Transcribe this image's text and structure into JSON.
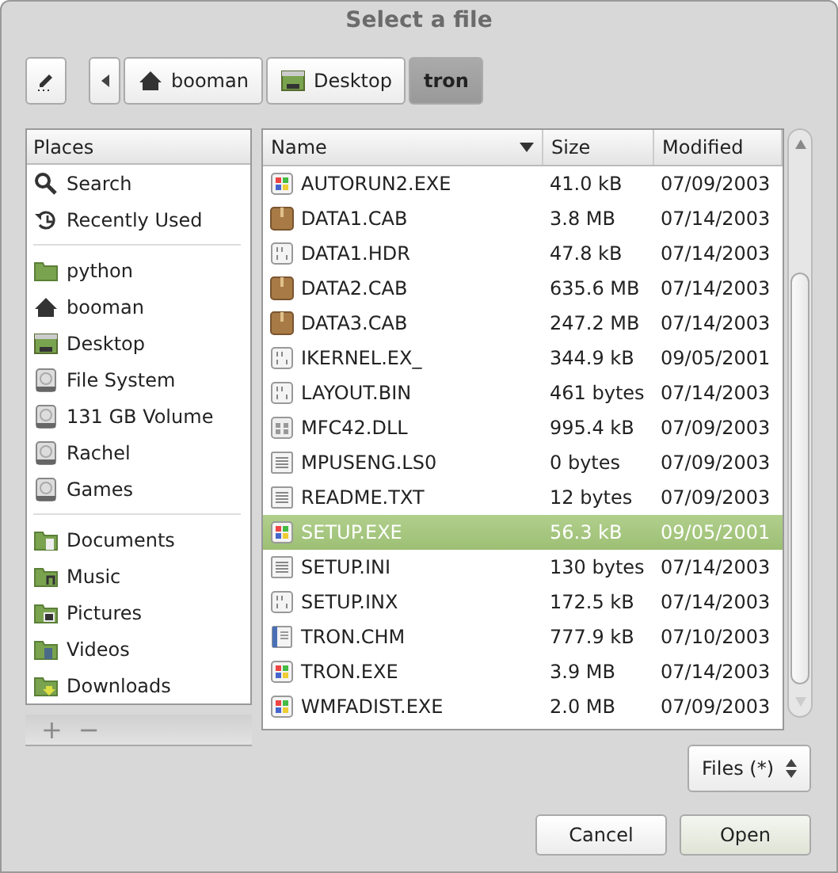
{
  "window": {
    "title": "Select a file"
  },
  "path_bar": {
    "buttons": [
      {
        "label": "booman",
        "kind": "home",
        "selected": false
      },
      {
        "label": "Desktop",
        "kind": "desktop",
        "selected": false
      },
      {
        "label": "tron",
        "kind": "plain",
        "selected": true
      }
    ]
  },
  "places": {
    "header": "Places",
    "sections": [
      [
        {
          "label": "Search",
          "kind": "search"
        },
        {
          "label": "Recently Used",
          "kind": "recent"
        }
      ],
      [
        {
          "label": "python",
          "kind": "folder"
        },
        {
          "label": "booman",
          "kind": "home"
        },
        {
          "label": "Desktop",
          "kind": "desktop"
        },
        {
          "label": "File System",
          "kind": "drive"
        },
        {
          "label": "131 GB Volume",
          "kind": "drive"
        },
        {
          "label": "Rachel",
          "kind": "drive"
        },
        {
          "label": "Games",
          "kind": "drive"
        }
      ],
      [
        {
          "label": "Documents",
          "kind": "documents"
        },
        {
          "label": "Music",
          "kind": "music"
        },
        {
          "label": "Pictures",
          "kind": "pictures"
        },
        {
          "label": "Videos",
          "kind": "videos"
        },
        {
          "label": "Downloads",
          "kind": "downloads"
        }
      ]
    ],
    "add_button": "+",
    "remove_button": "−"
  },
  "file_list": {
    "columns": [
      "Name",
      "Size",
      "Modified"
    ],
    "rows": [
      {
        "name": "AUTORUN2.EXE",
        "size": "41.0 kB",
        "modified": "07/09/2003",
        "kind": "exe",
        "selected": false
      },
      {
        "name": "DATA1.CAB",
        "size": "3.8 MB",
        "modified": "07/14/2003",
        "kind": "package",
        "selected": false
      },
      {
        "name": "DATA1.HDR",
        "size": "47.8 kB",
        "modified": "07/14/2003",
        "kind": "binary",
        "selected": false
      },
      {
        "name": "DATA2.CAB",
        "size": "635.6 MB",
        "modified": "07/14/2003",
        "kind": "package",
        "selected": false
      },
      {
        "name": "DATA3.CAB",
        "size": "247.2 MB",
        "modified": "07/14/2003",
        "kind": "package",
        "selected": false
      },
      {
        "name": "IKERNEL.EX_",
        "size": "344.9 kB",
        "modified": "09/05/2001",
        "kind": "binary",
        "selected": false
      },
      {
        "name": "LAYOUT.BIN",
        "size": "461 bytes",
        "modified": "07/14/2003",
        "kind": "binary",
        "selected": false
      },
      {
        "name": "MFC42.DLL",
        "size": "995.4 kB",
        "modified": "07/09/2003",
        "kind": "dll",
        "selected": false
      },
      {
        "name": "MPUSENG.LS0",
        "size": "0 bytes",
        "modified": "07/09/2003",
        "kind": "text",
        "selected": false
      },
      {
        "name": "README.TXT",
        "size": "12 bytes",
        "modified": "07/09/2003",
        "kind": "text",
        "selected": false
      },
      {
        "name": "SETUP.EXE",
        "size": "56.3 kB",
        "modified": "09/05/2001",
        "kind": "exe",
        "selected": true
      },
      {
        "name": "SETUP.INI",
        "size": "130 bytes",
        "modified": "07/14/2003",
        "kind": "text",
        "selected": false
      },
      {
        "name": "SETUP.INX",
        "size": "172.5 kB",
        "modified": "07/14/2003",
        "kind": "binary",
        "selected": false
      },
      {
        "name": "TRON.CHM",
        "size": "777.9 kB",
        "modified": "07/10/2003",
        "kind": "book",
        "selected": false
      },
      {
        "name": "TRON.EXE",
        "size": "3.9 MB",
        "modified": "07/14/2003",
        "kind": "exe",
        "selected": false
      },
      {
        "name": "WMFADIST.EXE",
        "size": "2.0 MB",
        "modified": "07/09/2003",
        "kind": "exe",
        "selected": false
      }
    ]
  },
  "filter": {
    "value": "Files (*)"
  },
  "buttons": [
    {
      "label": "Cancel",
      "kind": "secondary"
    },
    {
      "label": "Open",
      "kind": "primary"
    }
  ]
}
